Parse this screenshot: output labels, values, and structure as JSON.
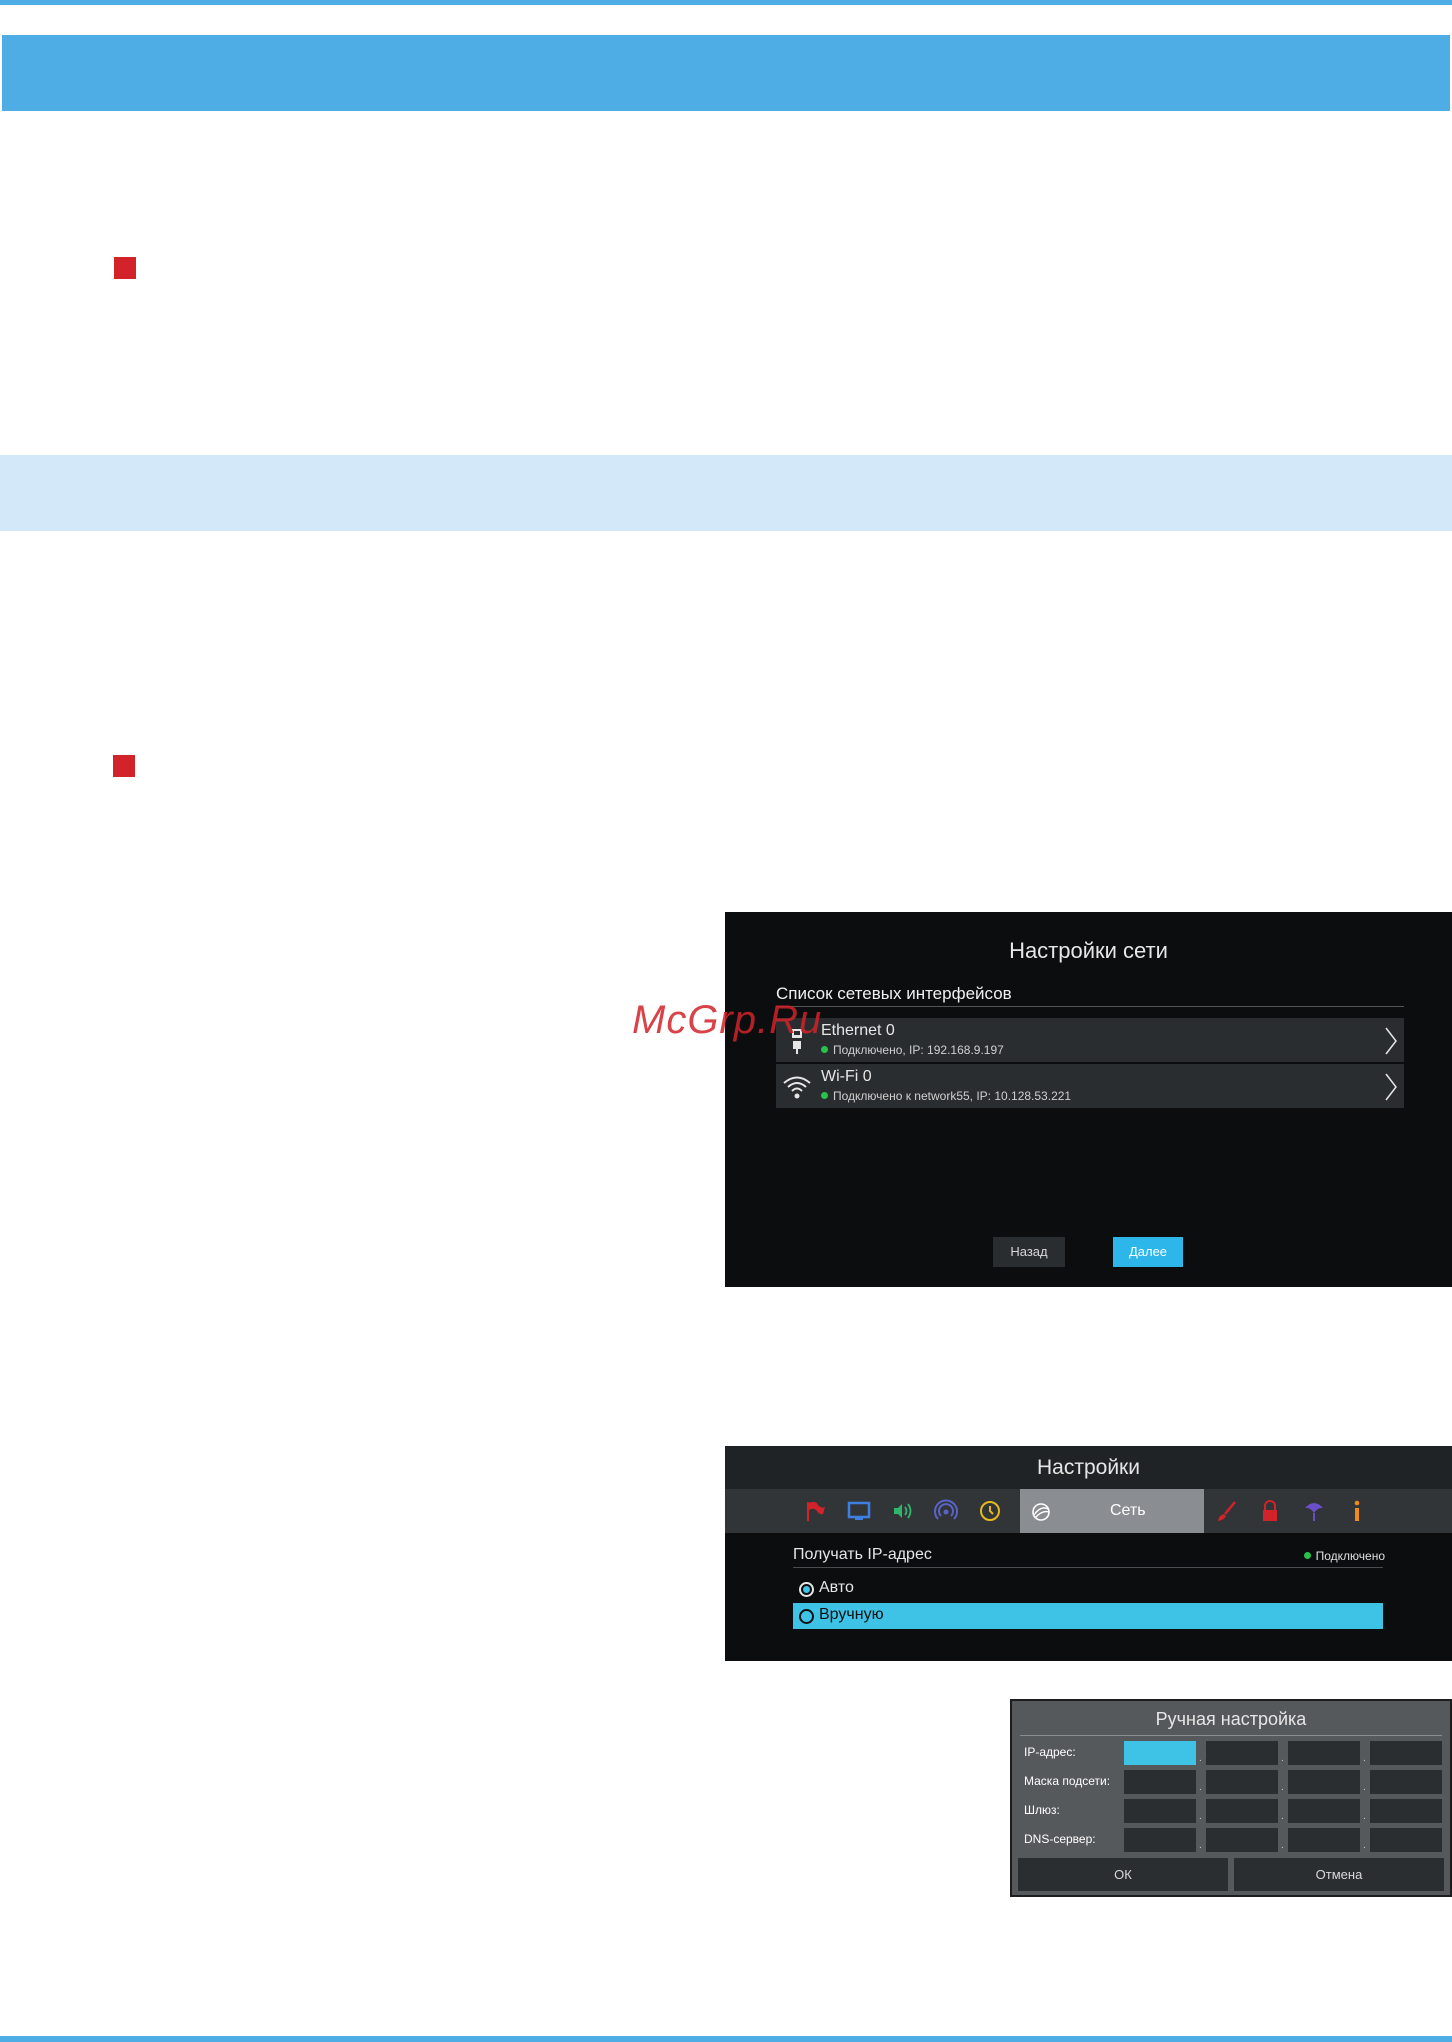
{
  "watermark": "McGrp.Ru",
  "network_screen": {
    "title": "Настройки сети",
    "list_heading": "Список сетевых интерфейсов",
    "interfaces": [
      {
        "name": "Ethernet 0",
        "status": "Подключено, IP: 192.168.9.197",
        "icon": "ethernet-plug-icon"
      },
      {
        "name": "Wi-Fi 0",
        "status": "Подключено к network55, IP: 10.128.53.221",
        "icon": "wifi-icon"
      }
    ],
    "back_label": "Назад",
    "next_label": "Далее"
  },
  "settings_screen": {
    "title": "Настройки",
    "tab_icons": [
      "flag-icon",
      "tv-icon",
      "volume-icon",
      "broadcast-icon",
      "clock-icon",
      "network-icon",
      "brush-icon",
      "lock-icon",
      "balloon-icon",
      "info-icon"
    ],
    "active_tab_label": "Сеть",
    "section_label": "Получать IP-адрес",
    "status": "Подключено",
    "options": [
      "Авто",
      "Вручную"
    ],
    "selected_option": "Авто",
    "highlighted_option": "Вручную"
  },
  "manual_screen": {
    "title": "Ручная настройка",
    "fields": [
      "IP-адрес:",
      "Маска подсети:",
      "Шлюз:",
      "DNS-сервер:"
    ],
    "ok_label": "ОК",
    "cancel_label": "Отмена"
  },
  "colors": {
    "accent_blue": "#4fade6",
    "band_light": "#d3e8f8",
    "bullet_red": "#d2232a",
    "highlight_cyan": "#3ec3e6",
    "status_green": "#27c24c"
  }
}
